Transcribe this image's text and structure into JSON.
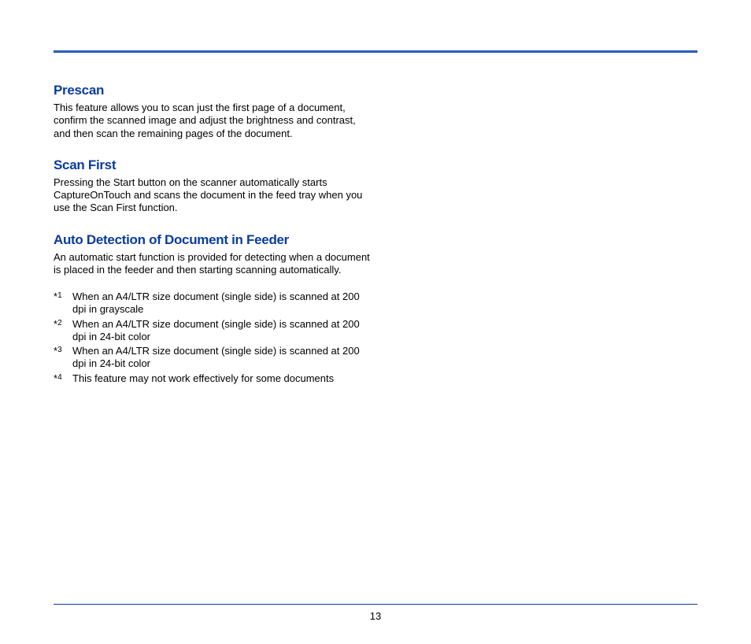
{
  "sections": [
    {
      "heading": "Prescan",
      "body": "This feature allows you to scan just the first page of a document, confirm the scanned image and adjust the brightness and contrast, and then scan the remaining pages of the document."
    },
    {
      "heading": "Scan First",
      "body": "Pressing the Start button on the scanner automatically starts CaptureOnTouch and scans the document in the feed tray when you use the Scan First function."
    },
    {
      "heading": "Auto Detection of Document in Feeder",
      "body": "An automatic start function is provided for detecting when a document is placed in the feeder and then starting scanning automatically."
    }
  ],
  "footnotes": [
    {
      "num": "1",
      "text": "When an A4/LTR size document (single side) is scanned at 200 dpi in grayscale"
    },
    {
      "num": "2",
      "text": "When an A4/LTR size document (single side) is scanned at 200 dpi in 24-bit color"
    },
    {
      "num": "3",
      "text": "When an A4/LTR size document (single side) is scanned at 200 dpi in 24-bit color"
    },
    {
      "num": "4",
      "text": "This feature may not work effectively for some documents"
    }
  ],
  "page_number": "13"
}
